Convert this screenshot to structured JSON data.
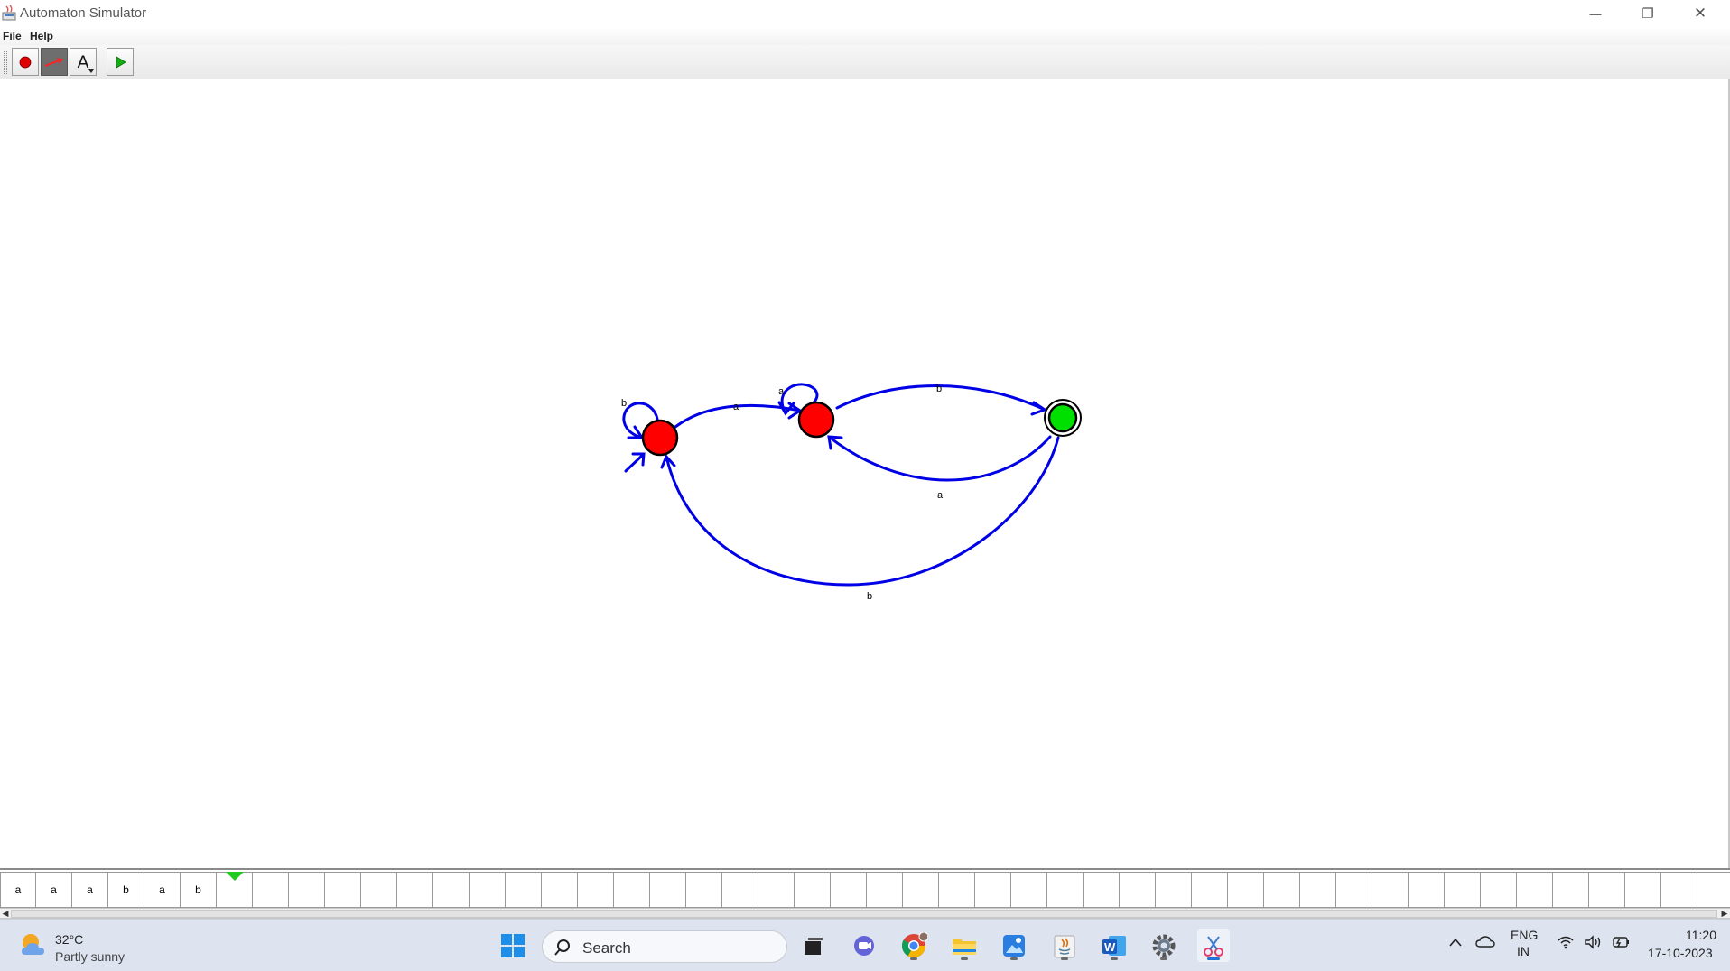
{
  "window": {
    "title": "Automaton Simulator",
    "controls": {
      "minimize": "—",
      "restore": "❐",
      "close": "✕"
    }
  },
  "menubar": {
    "items": [
      {
        "label": "File"
      },
      {
        "label": "Help"
      }
    ]
  },
  "toolbar": {
    "tools": [
      {
        "name": "add-state-tool",
        "icon": "red-dot-icon",
        "pressed": false
      },
      {
        "name": "add-transition-tool",
        "icon": "red-arrow-icon",
        "pressed": true
      },
      {
        "name": "add-text-tool",
        "icon": "text-A-icon",
        "label": "A",
        "pressed": false
      },
      {
        "name": "run-tool",
        "icon": "green-play-icon",
        "pressed": false
      }
    ]
  },
  "automaton": {
    "states": [
      {
        "id": "q0",
        "kind": "initial",
        "color": "#ff0000"
      },
      {
        "id": "q1",
        "kind": "normal",
        "color": "#ff0000"
      },
      {
        "id": "q2",
        "kind": "accepting",
        "color": "#00e000"
      }
    ],
    "transitions": [
      {
        "from": "q0",
        "to": "q0",
        "symbol": "b"
      },
      {
        "from": "q0",
        "to": "q1",
        "symbol": "a"
      },
      {
        "from": "q1",
        "to": "q1",
        "symbol": "a"
      },
      {
        "from": "q1",
        "to": "q2",
        "symbol": "b"
      },
      {
        "from": "q2",
        "to": "q1",
        "symbol": "a"
      },
      {
        "from": "q2",
        "to": "q0",
        "symbol": "b"
      }
    ],
    "edge_color": "#0000e6"
  },
  "tape": {
    "symbols": [
      "a",
      "a",
      "a",
      "b",
      "a",
      "b"
    ],
    "total_cells": 48,
    "head_index": 6,
    "head_color": "#1ecb1e"
  },
  "taskbar": {
    "weather": {
      "temp": "32°C",
      "desc": "Partly sunny"
    },
    "search_placeholder": "Search",
    "apps": [
      "windows-start-icon",
      "task-view-icon",
      "teams-chat-icon",
      "chrome-icon",
      "file-explorer-icon",
      "photos-icon",
      "java-icon",
      "word-icon",
      "settings-icon",
      "snipping-tool-icon"
    ],
    "tray": {
      "lang1": "ENG",
      "lang2": "IN",
      "time": "11:20",
      "date": "17-10-2023"
    }
  }
}
